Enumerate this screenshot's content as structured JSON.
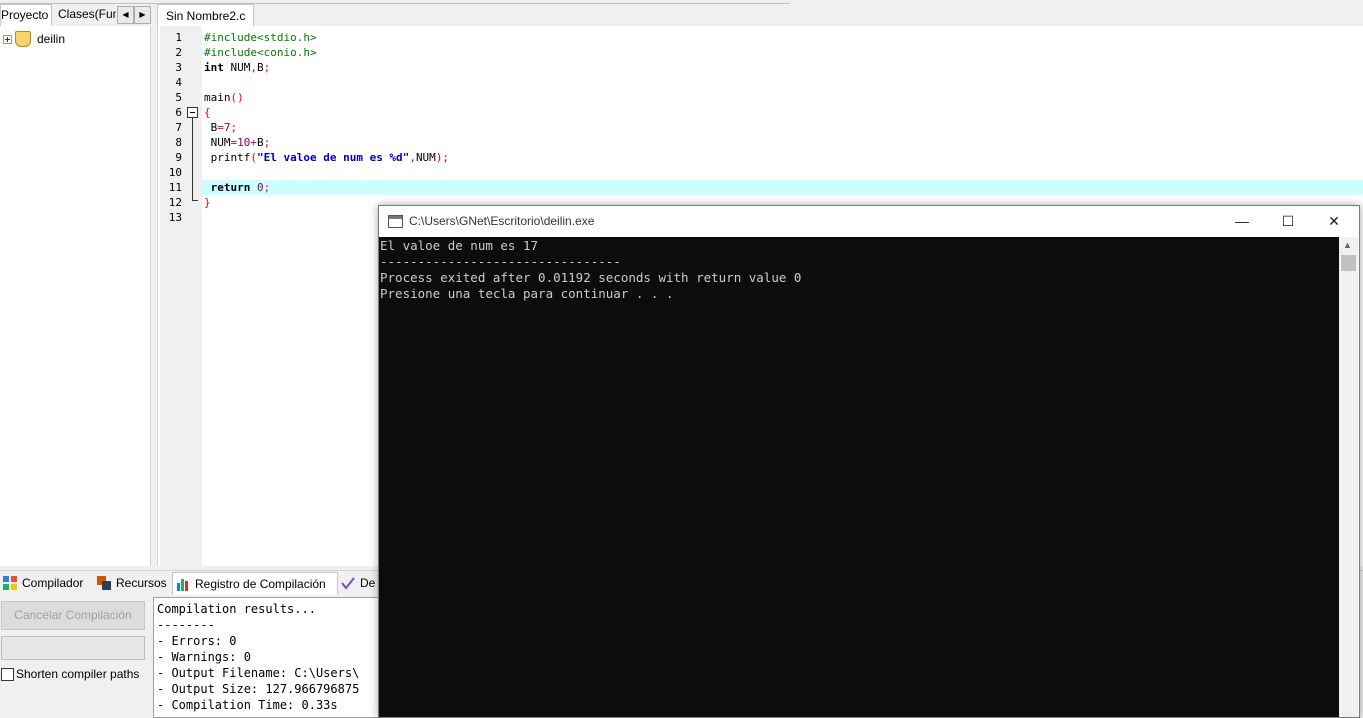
{
  "left_panel": {
    "tabs": [
      "Proyecto",
      "Clases(Fun"
    ],
    "tree_item": "deilin"
  },
  "editor": {
    "tab_label": "Sin Nombre2.c",
    "line_numbers": [
      "1",
      "2",
      "3",
      "4",
      "5",
      "6",
      "7",
      "8",
      "9",
      "10",
      "11",
      "12",
      "13"
    ]
  },
  "bottom_tabs": {
    "compilador": "Compilador",
    "recursos": "Recursos",
    "registro": "Registro de Compilación",
    "depurar": "De"
  },
  "build_panel": {
    "cancel_label": "Cancelar Compilación",
    "shorten_label": "Shorten compiler paths"
  },
  "log_lines": [
    "Compilation results...",
    "--------",
    "- Errors: 0",
    "- Warnings: 0",
    "- Output Filename: C:\\Users\\",
    "- Output Size: 127.966796875",
    "- Compilation Time: 0.33s"
  ],
  "console": {
    "title": "C:\\Users\\GNet\\Escritorio\\deilin.exe",
    "lines": [
      "El valoe de num es 17",
      "--------------------------------",
      "Process exited after 0.01192 seconds with return value 0",
      "Presione una tecla para continuar . . ."
    ]
  },
  "colors": {
    "current_line": "#ccffff",
    "console_bg": "#0c0c0c",
    "console_text": "#cccccc",
    "preprocessor": "#008000",
    "string": "#0000c0",
    "number": "#800080",
    "symbol": "#ff0000"
  },
  "icons": [
    "plus-expand-icon",
    "project-icon",
    "compiler-icon",
    "resources-icon",
    "chart-icon",
    "debug-check-icon",
    "console-app-icon",
    "minimize-icon",
    "maximize-icon",
    "close-icon"
  ]
}
